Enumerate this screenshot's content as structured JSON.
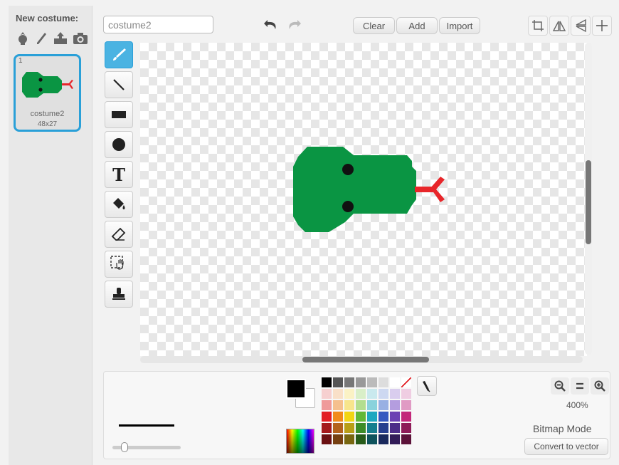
{
  "costumes_panel": {
    "new_costume_label": "New costume:",
    "tools": [
      "choose-from-library-icon",
      "paint-new-icon",
      "upload-icon",
      "camera-icon"
    ],
    "items": [
      {
        "number": "1",
        "name": "costume2",
        "size": "48x27",
        "selected": true
      }
    ]
  },
  "editor": {
    "costume_name_value": "costume2",
    "undo_icon": "undo-icon",
    "redo_icon": "redo-icon",
    "clear_label": "Clear",
    "add_label": "Add",
    "import_label": "Import",
    "right_tools": [
      "crop-icon",
      "flip-horizontal-icon",
      "flip-vertical-icon",
      "set-center-icon"
    ],
    "tools": [
      {
        "name": "paintbrush",
        "icon": "brush-icon",
        "active": true
      },
      {
        "name": "line",
        "icon": "line-icon",
        "active": false
      },
      {
        "name": "rectangle",
        "icon": "rectangle-icon",
        "active": false
      },
      {
        "name": "ellipse",
        "icon": "ellipse-icon",
        "active": false
      },
      {
        "name": "text",
        "icon": "text-icon",
        "glyph": "T",
        "active": false
      },
      {
        "name": "fill",
        "icon": "fill-bucket-icon",
        "active": false
      },
      {
        "name": "eraser",
        "icon": "eraser-icon",
        "active": false
      },
      {
        "name": "select",
        "icon": "select-icon",
        "active": false
      },
      {
        "name": "stamp",
        "icon": "stamp-icon",
        "active": false
      }
    ],
    "sprite_colors": {
      "body": "#0a9543",
      "eyes": "#111111",
      "tongue": "#e8262a"
    }
  },
  "bottom": {
    "foreground_color": "#000000",
    "background_color": "#ffffff",
    "zoom_out_icon": "zoom-out-icon",
    "zoom_reset_icon": "zoom-reset-icon",
    "zoom_in_icon": "zoom-in-icon",
    "zoom_level": "400%",
    "mode_label": "Bitmap Mode",
    "convert_label": "Convert to vector",
    "swatches": [
      "#000000",
      "#555555",
      "#777777",
      "#999999",
      "#bbbbbb",
      "#dddddd",
      "#ffffff",
      "transparent",
      "#f6d0d0",
      "#f9e0c8",
      "#fbf2c5",
      "#d9efc8",
      "#c9e9ee",
      "#cdd8f1",
      "#d9cdee",
      "#efcde2",
      "#ef9a9a",
      "#f5c08e",
      "#f7e58c",
      "#b3de8e",
      "#8ad2dc",
      "#98b0e3",
      "#b49ddf",
      "#e09ac4",
      "#e21d23",
      "#f18b1a",
      "#f2d513",
      "#62b837",
      "#1fa8c0",
      "#3658c0",
      "#6b41b3",
      "#c3287a",
      "#a4191b",
      "#b4621b",
      "#b89e16",
      "#3d8c27",
      "#167e8e",
      "#263e8e",
      "#4c2c88",
      "#8e1c58",
      "#6a1011",
      "#764011",
      "#786710",
      "#275b19",
      "#0e525c",
      "#19295c",
      "#321c58",
      "#5c1239"
    ]
  }
}
